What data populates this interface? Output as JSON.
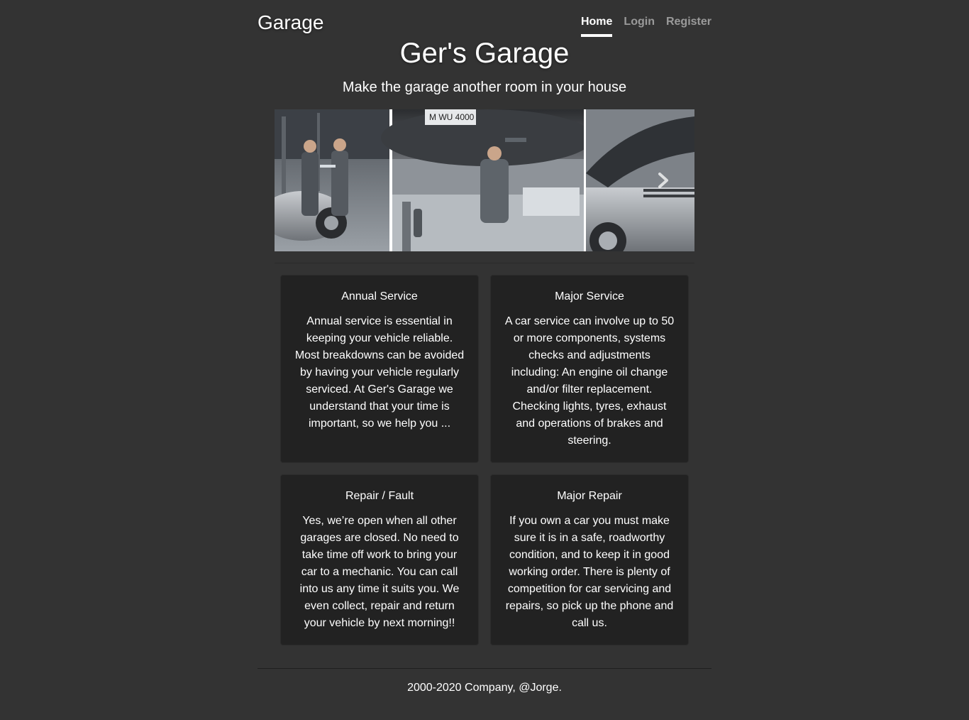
{
  "header": {
    "brand": "Garage",
    "nav": [
      {
        "label": "Home",
        "active": true
      },
      {
        "label": "Login",
        "active": false
      },
      {
        "label": "Register",
        "active": false
      }
    ]
  },
  "hero": {
    "title": "Ger's Garage",
    "subtitle": "Make the garage another room in your house"
  },
  "carousel": {
    "next_icon": "chevron-right-icon",
    "plate_text": "M WU 4000"
  },
  "services": [
    {
      "title": "Annual Service",
      "body": "Annual service is essential in keeping your vehicle reliable. Most breakdowns can be avoided by having your vehicle regularly serviced. At Ger's Garage we understand that your time is important, so we help you ..."
    },
    {
      "title": "Major Service",
      "body": "A car service can involve up to 50 or more components, systems checks and adjustments including: An engine oil change and/or filter replacement. Checking lights, tyres, exhaust and operations of brakes and steering."
    },
    {
      "title": "Repair / Fault",
      "body": "Yes, we’re open when all other garages are closed. No need to take time off work to bring your car to a mechanic. You can call into us any time it suits you. We even collect, repair and return your vehicle by next morning!!"
    },
    {
      "title": "Major Repair",
      "body": "If you own a car you must make sure it is in a safe, roadworthy condition, and to keep it in good working order. There is plenty of competition for car servicing and repairs, so pick up the phone and call us."
    }
  ],
  "footer": {
    "text": "2000-2020 Company, @Jorge."
  },
  "colors": {
    "background": "#333333",
    "card": "#222222",
    "text": "#ffffff"
  }
}
